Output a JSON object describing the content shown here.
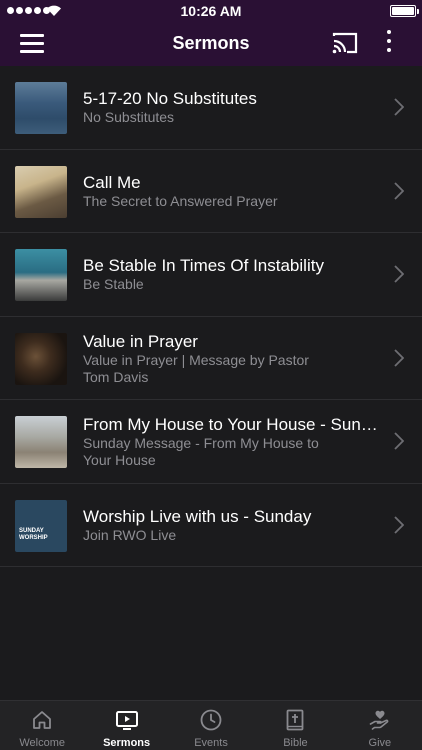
{
  "status_bar": {
    "time": "10:26 AM"
  },
  "header": {
    "title": "Sermons"
  },
  "sermons": [
    {
      "title": "5-17-20 No Substitutes",
      "subtitle": "No Substitutes"
    },
    {
      "title": "Call Me",
      "subtitle": "The Secret to Answered Prayer"
    },
    {
      "title": "Be Stable In Times Of Instability",
      "subtitle": "Be Stable"
    },
    {
      "title": "Value in Prayer",
      "subtitle_line1": "Value in Prayer | Message by Pastor",
      "subtitle_line2": "Tom Davis"
    },
    {
      "title": "From My House to Your House - Sund...",
      "subtitle_line1": "Sunday Message - From My House to",
      "subtitle_line2": "Your House"
    },
    {
      "title": "Worship Live with us - Sunday",
      "subtitle": "Join RWO Live",
      "thumb_text_line1": "SUNDAY",
      "thumb_text_line2": "WORSHIP"
    }
  ],
  "tabs": [
    {
      "label": "Welcome",
      "icon": "home-icon",
      "active": false
    },
    {
      "label": "Sermons",
      "icon": "play-video-icon",
      "active": true
    },
    {
      "label": "Events",
      "icon": "clock-icon",
      "active": false
    },
    {
      "label": "Bible",
      "icon": "bible-icon",
      "active": false
    },
    {
      "label": "Give",
      "icon": "give-hand-heart-icon",
      "active": false
    }
  ],
  "colors": {
    "header_bg": "#2a1034",
    "list_bg": "#1b1b1d",
    "tabbar_bg": "#232325",
    "subtitle": "#8e8e93",
    "inactive_tab": "#8a8a8f"
  }
}
